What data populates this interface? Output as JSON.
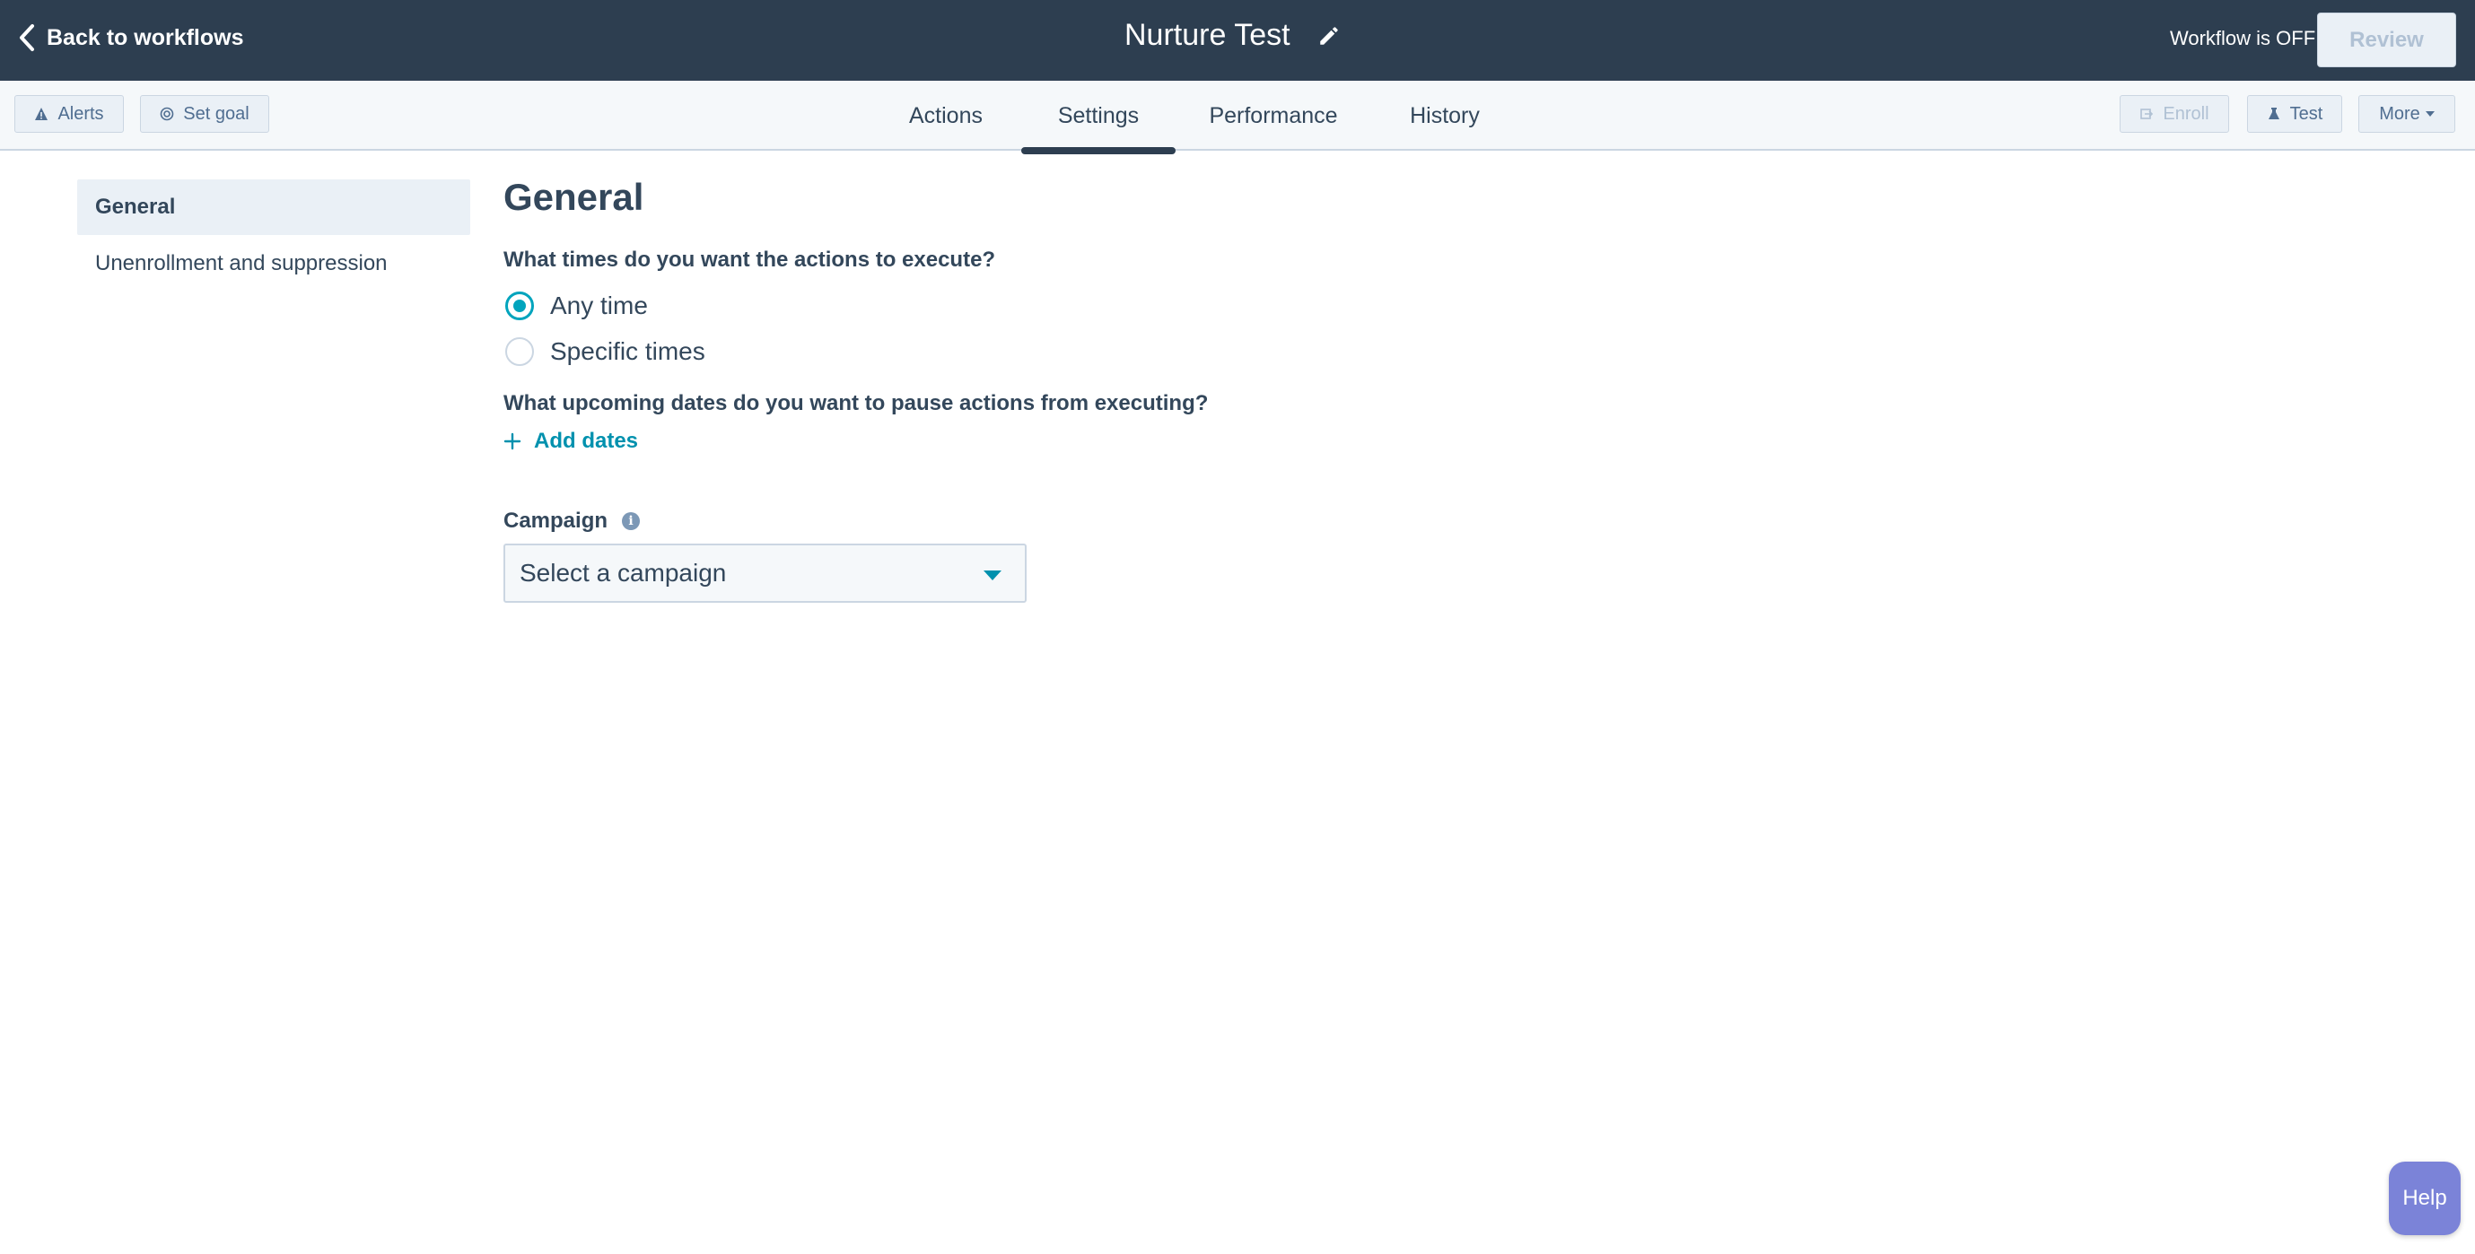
{
  "header": {
    "back_label": "Back to workflows",
    "title": "Nurture Test",
    "status": "Workflow is OFF",
    "review_label": "Review"
  },
  "toolbar": {
    "alerts_label": "Alerts",
    "set_goal_label": "Set goal",
    "enroll_label": "Enroll",
    "test_label": "Test",
    "more_label": "More"
  },
  "tabs": [
    {
      "label": "Actions",
      "active": false
    },
    {
      "label": "Settings",
      "active": true
    },
    {
      "label": "Performance",
      "active": false
    },
    {
      "label": "History",
      "active": false
    }
  ],
  "sidebar": {
    "items": [
      {
        "label": "General",
        "active": true
      },
      {
        "label": "Unenrollment and suppression",
        "active": false
      }
    ]
  },
  "main": {
    "title": "General",
    "execute_question": "What times do you want the actions to execute?",
    "options": [
      {
        "label": "Any time",
        "checked": true
      },
      {
        "label": "Specific times",
        "checked": false
      }
    ],
    "pause_question": "What upcoming dates do you want to pause actions from executing?",
    "add_dates_label": "Add dates",
    "campaign_label": "Campaign",
    "campaign_placeholder": "Select a campaign"
  },
  "help_label": "Help",
  "colors": {
    "header_bg": "#2d3e50",
    "accent": "#00a4bd",
    "link": "#0091ae",
    "help_bg": "#7b83d8"
  }
}
